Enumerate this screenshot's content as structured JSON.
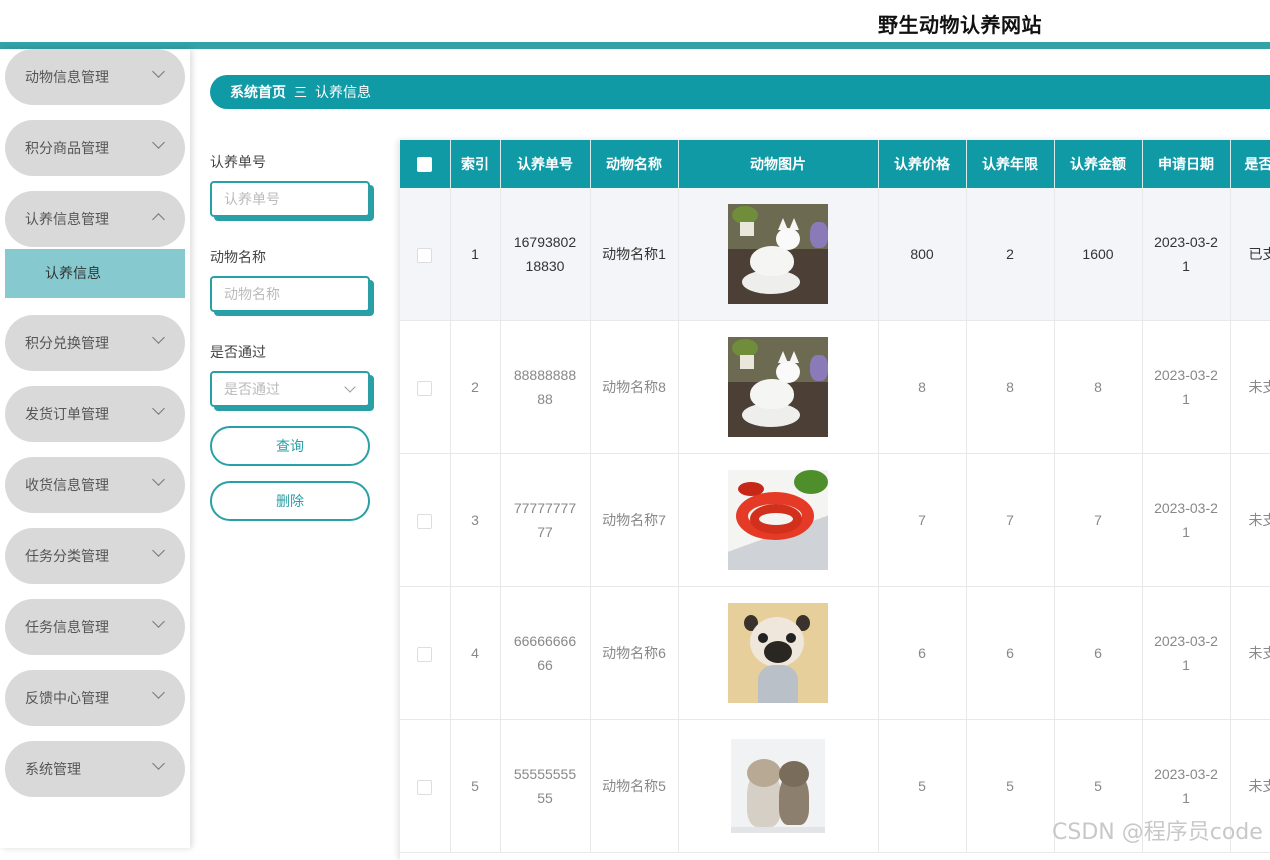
{
  "header": {
    "title": "野生动物认养网站"
  },
  "sidebar": {
    "items": [
      {
        "label": "动物信息管理",
        "expanded": false
      },
      {
        "label": "积分商品管理",
        "expanded": false
      },
      {
        "label": "认养信息管理",
        "expanded": true
      },
      {
        "label": "积分兑换管理",
        "expanded": false
      },
      {
        "label": "发货订单管理",
        "expanded": false
      },
      {
        "label": "收货信息管理",
        "expanded": false
      },
      {
        "label": "任务分类管理",
        "expanded": false
      },
      {
        "label": "任务信息管理",
        "expanded": false
      },
      {
        "label": "反馈中心管理",
        "expanded": false
      },
      {
        "label": "系统管理",
        "expanded": false
      }
    ],
    "active_subitem": "认养信息"
  },
  "breadcrumb": {
    "home": "系统首页",
    "separator": "三",
    "current": "认养信息"
  },
  "filters": {
    "order_no": {
      "label": "认养单号",
      "placeholder": "认养单号"
    },
    "animal_name": {
      "label": "动物名称",
      "placeholder": "动物名称"
    },
    "approved": {
      "label": "是否通过",
      "placeholder": "是否通过"
    },
    "query_button": "查询",
    "delete_button": "删除"
  },
  "table": {
    "columns": [
      "索引",
      "认养单号",
      "动物名称",
      "动物图片",
      "认养价格",
      "认养年限",
      "认养金额",
      "申请日期",
      "是否"
    ],
    "rows": [
      {
        "index": "1",
        "order_no": "1679380218830",
        "name": "动物名称1",
        "image": "white-fox",
        "price": "800",
        "years": "2",
        "amount": "1600",
        "date": "2023-03-21",
        "status": "已支"
      },
      {
        "index": "2",
        "order_no": "8888888888",
        "name": "动物名称8",
        "image": "white-fox",
        "price": "8",
        "years": "8",
        "amount": "8",
        "date": "2023-03-21",
        "status": "未支"
      },
      {
        "index": "3",
        "order_no": "7777777777",
        "name": "动物名称7",
        "image": "red-snake",
        "price": "7",
        "years": "7",
        "amount": "7",
        "date": "2023-03-21",
        "status": "未支"
      },
      {
        "index": "4",
        "order_no": "6666666666",
        "name": "动物名称6",
        "image": "pug-dog",
        "price": "6",
        "years": "6",
        "amount": "6",
        "date": "2023-03-21",
        "status": "未支"
      },
      {
        "index": "5",
        "order_no": "5555555555",
        "name": "动物名称5",
        "image": "kittens",
        "price": "5",
        "years": "5",
        "amount": "5",
        "date": "2023-03-21",
        "status": "未支"
      }
    ]
  },
  "watermark": "CSDN @程序员code",
  "colors": {
    "accent": "#0f9aa6",
    "header_bar": "#33a2a8",
    "sidebar_active": "#86cad0",
    "menu_bg": "#d9d9d9"
  }
}
